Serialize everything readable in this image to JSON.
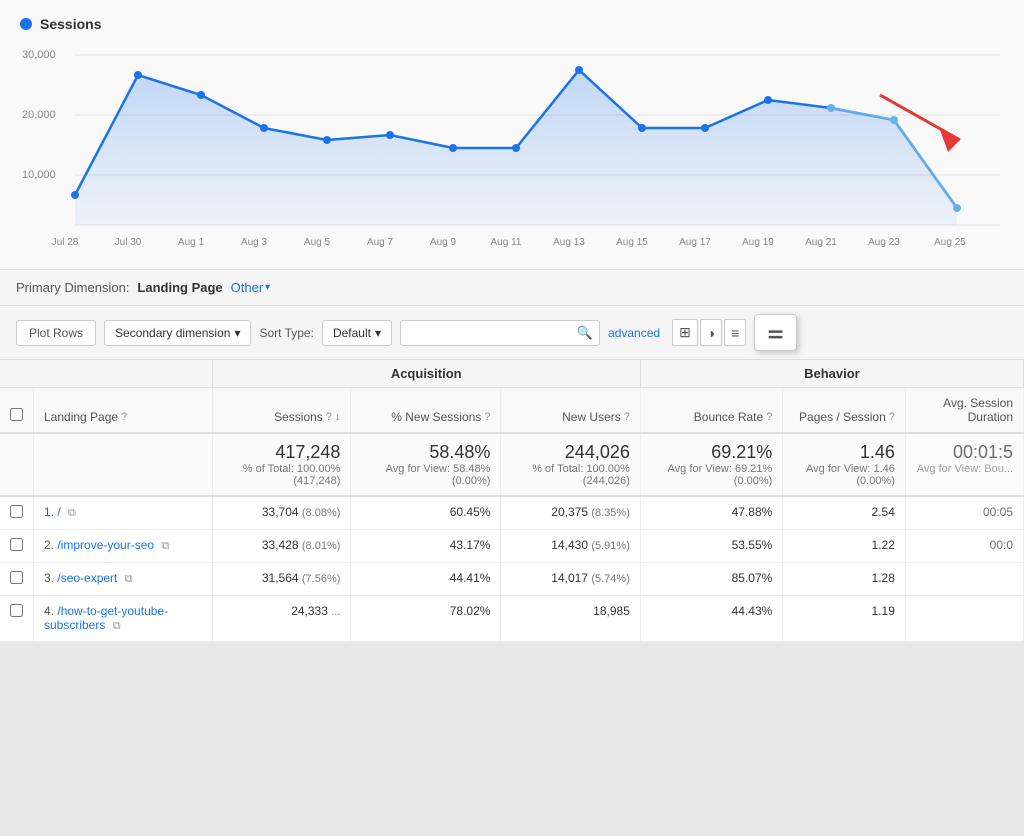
{
  "chart": {
    "legend_label": "Sessions",
    "y_labels": [
      "30,000",
      "20,000",
      "10,000"
    ],
    "x_labels": [
      "Jul 28",
      "Jul 30",
      "Aug 1",
      "Aug 3",
      "Aug 5",
      "Aug 7",
      "Aug 9",
      "Aug 11",
      "Aug 13",
      "Aug 15",
      "Aug 17",
      "Aug 19",
      "Aug 21",
      "Aug 23",
      "Aug 25"
    ],
    "accent_color": "#1a73e8"
  },
  "primary_dimension": {
    "label": "Primary Dimension:",
    "value": "Landing Page",
    "other_label": "Other",
    "dropdown_arrow": "▾"
  },
  "toolbar": {
    "plot_rows_label": "Plot Rows",
    "secondary_dimension_label": "Secondary dimension",
    "sort_type_label": "Sort Type:",
    "sort_default_label": "Default",
    "dropdown_arrow": "▾",
    "search_placeholder": "",
    "advanced_label": "advanced"
  },
  "icons": {
    "search": "🔍",
    "grid": "⊞",
    "pie": "◑",
    "more": "≡",
    "customize": "⚌"
  },
  "table": {
    "col_groups": [
      {
        "label": "",
        "span": 2
      },
      {
        "label": "Acquisition",
        "span": 3
      },
      {
        "label": "Behavior",
        "span": 3
      }
    ],
    "columns": [
      {
        "id": "landing-page",
        "label": "Landing Page",
        "info": true,
        "sort": false
      },
      {
        "id": "sessions",
        "label": "Sessions",
        "info": true,
        "sort": true
      },
      {
        "id": "new-sessions-pct",
        "label": "% New Sessions",
        "info": true,
        "sort": false
      },
      {
        "id": "new-users",
        "label": "New Users",
        "info": true,
        "sort": false
      },
      {
        "id": "bounce-rate",
        "label": "Bounce Rate",
        "info": true,
        "sort": false
      },
      {
        "id": "pages-session",
        "label": "Pages / Session",
        "info": true,
        "sort": false
      },
      {
        "id": "avg-session-duration",
        "label": "Avg. Session Duration",
        "info": false,
        "sort": false
      }
    ],
    "totals": {
      "sessions_main": "417,248",
      "sessions_sub": "% of Total: 100.00% (417,248)",
      "new_sessions_pct_main": "58.48%",
      "new_sessions_pct_sub": "Avg for View: 58.48% (0.00%)",
      "new_users_main": "244,026",
      "new_users_sub": "% of Total: 100.00% (244,026)",
      "bounce_rate_main": "69.21%",
      "bounce_rate_sub": "Avg for View: 69.21% (0.00%)",
      "pages_session_main": "1.46",
      "pages_session_sub": "Avg for View: 1.46 (0.00%)",
      "avg_duration_main": "00:01:5",
      "avg_duration_sub": "Avg for View: Bou..."
    },
    "rows": [
      {
        "num": "1.",
        "page": "/",
        "sessions": "33,704",
        "sessions_pct": "(8.08%)",
        "new_sessions_pct": "60.45%",
        "new_users": "20,375",
        "new_users_pct": "(8.35%)",
        "bounce_rate": "47.88%",
        "pages_session": "2.54",
        "avg_duration": "00:05"
      },
      {
        "num": "2.",
        "page": "/improve-your-seo",
        "sessions": "33,428",
        "sessions_pct": "(8.01%)",
        "new_sessions_pct": "43.17%",
        "new_users": "14,430",
        "new_users_pct": "(5.91%)",
        "bounce_rate": "53.55%",
        "pages_session": "1.22",
        "avg_duration": "00:0"
      },
      {
        "num": "3.",
        "page": "/seo-expert",
        "sessions": "31,564",
        "sessions_pct": "(7.56%)",
        "new_sessions_pct": "44.41%",
        "new_users": "14,017",
        "new_users_pct": "(5.74%)",
        "bounce_rate": "85.07%",
        "pages_session": "1.28",
        "avg_duration": ""
      },
      {
        "num": "4.",
        "page": "/how-to-get-youtube-subscribers",
        "sessions": "24,333",
        "sessions_pct": "...",
        "new_sessions_pct": "78.02%",
        "new_users": "18,985",
        "new_users_pct": "",
        "bounce_rate": "44.43%",
        "pages_session": "1.19",
        "avg_duration": ""
      }
    ]
  },
  "red_arrow": {
    "visible": true
  }
}
